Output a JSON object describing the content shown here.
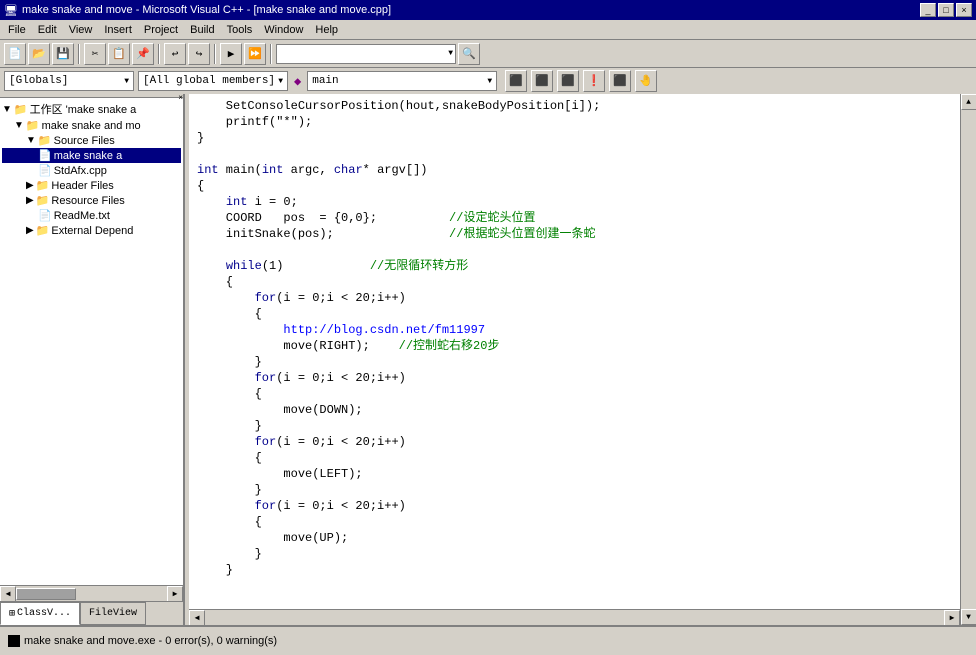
{
  "titleBar": {
    "text": "make snake and move - Microsoft Visual C++ - [make snake and move.cpp]",
    "buttons": [
      "_",
      "□",
      "×"
    ]
  },
  "menuBar": {
    "items": [
      "File",
      "Edit",
      "View",
      "Insert",
      "Project",
      "Build",
      "Tools",
      "Window",
      "Help"
    ]
  },
  "toolbar1": {
    "buttons": [
      "new",
      "open",
      "save",
      "cut",
      "copy",
      "paste",
      "undo",
      "redo",
      "find"
    ]
  },
  "selector": {
    "scope": "[Globals]",
    "members": "[All global members]",
    "function": "main",
    "dotIcon": "◆"
  },
  "tree": {
    "items": [
      {
        "level": 0,
        "label": "工作区 'make snake a",
        "icon": "📁",
        "expanded": true
      },
      {
        "level": 1,
        "label": "make snake and mo",
        "icon": "📁",
        "expanded": true
      },
      {
        "level": 2,
        "label": "Source Files",
        "icon": "📁",
        "expanded": true
      },
      {
        "level": 3,
        "label": "make snake a",
        "icon": "📄",
        "selected": true
      },
      {
        "level": 3,
        "label": "StdAfx.cpp",
        "icon": "📄"
      },
      {
        "level": 2,
        "label": "Header Files",
        "icon": "📁",
        "expanded": false
      },
      {
        "level": 2,
        "label": "Resource Files",
        "icon": "📁",
        "expanded": false
      },
      {
        "level": 2,
        "label": "ReadMe.txt",
        "icon": "📄"
      },
      {
        "level": 2,
        "label": "External Depend",
        "icon": "📁",
        "expanded": false
      }
    ]
  },
  "panelTabs": {
    "classView": "ClassV...",
    "fileView": "FileView"
  },
  "code": {
    "lines": [
      "    SetConsoleCursorPosition(hout,snakeBodyPosition[i]);",
      "    printf(\"*\");",
      "}",
      "",
      "int main(int argc, char* argv[])",
      "{",
      "    int i = 0;",
      "    COORD   pos  = {0,0};          //设定蛇头位置",
      "    initSnake(pos);                //根据蛇头位置创建一条蛇",
      "",
      "    while(1)            //无限循环转方形",
      "    {",
      "        for(i = 0;i < 20;i++)",
      "        {",
      "            http://blog.csdn.net/fm11997",
      "            move(RIGHT);    //控制蛇右移20步",
      "        }",
      "        for(i = 0;i < 20;i++)",
      "        {",
      "            move(DOWN);",
      "        }",
      "        for(i = 0;i < 20;i++)",
      "        {",
      "            move(LEFT);",
      "        }",
      "        for(i = 0;i < 20;i++)",
      "        {",
      "            move(UP);",
      "        }",
      "    }"
    ]
  },
  "statusBar": {
    "text": "make snake and move.exe - 0 error(s), 0 warning(s)"
  },
  "bottomBar": {
    "smallIcon": "■"
  }
}
